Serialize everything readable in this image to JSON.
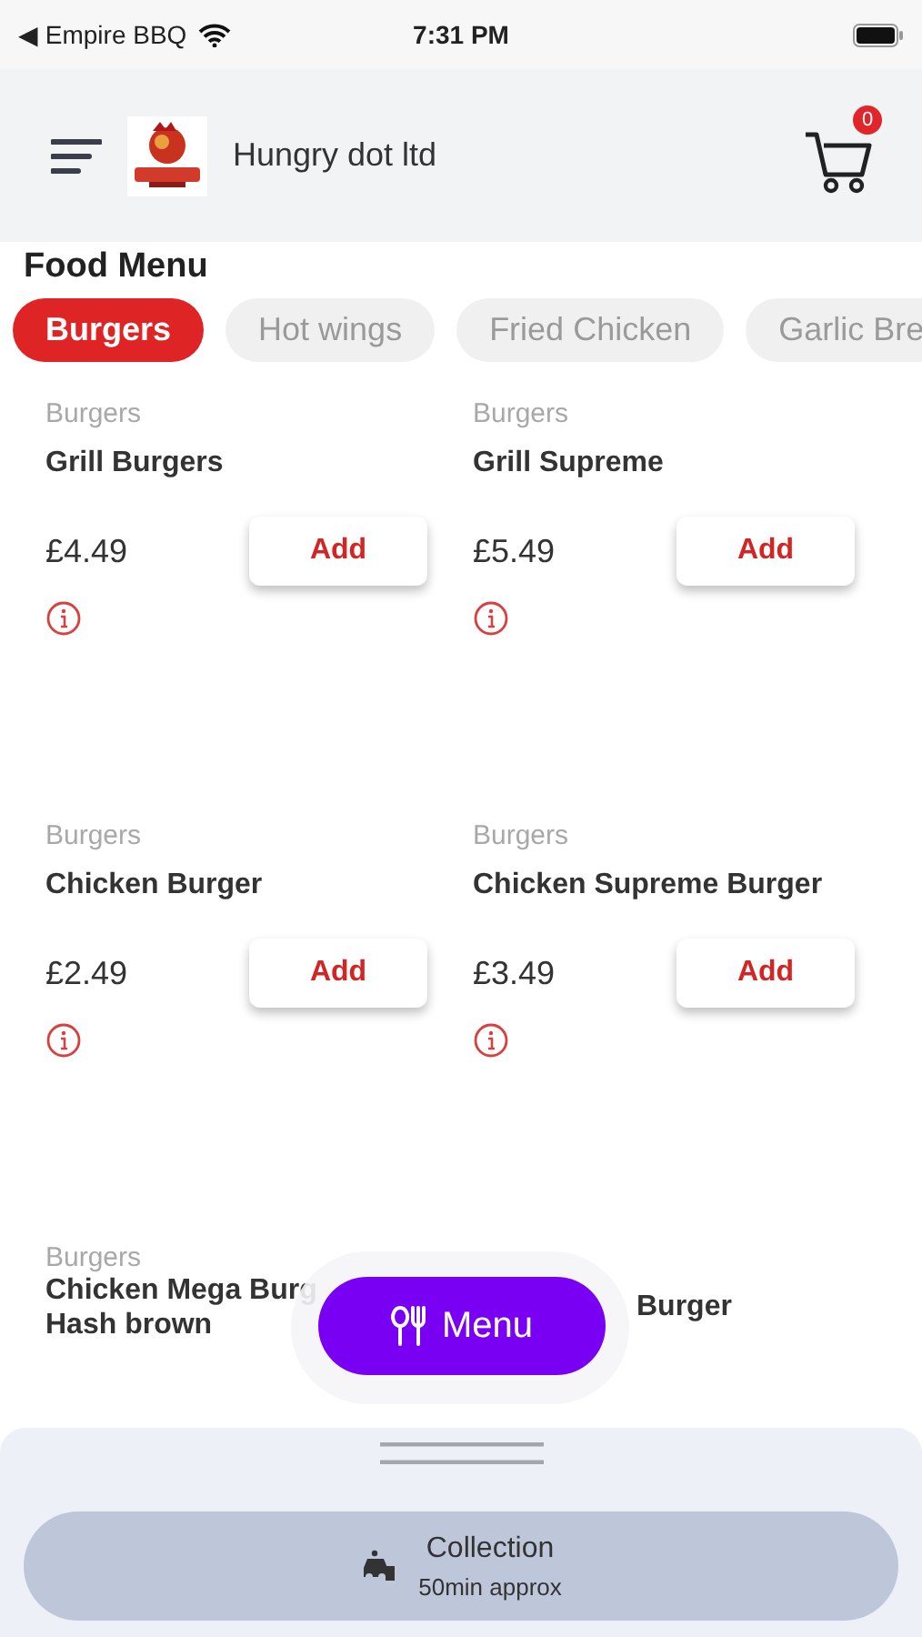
{
  "status_bar": {
    "back_app": "◀ Empire BBQ",
    "time": "7:31 PM"
  },
  "header": {
    "title": "Hungry dot ltd",
    "cart_count": "0"
  },
  "section_title": "Food Menu",
  "tabs": [
    {
      "label": "Burgers",
      "selected": true
    },
    {
      "label": "Hot wings",
      "selected": false
    },
    {
      "label": "Fried Chicken",
      "selected": false
    },
    {
      "label": "Garlic Bre",
      "selected": false
    }
  ],
  "items": [
    {
      "kind": "full",
      "category": "Burgers",
      "name": "Grill Burgers",
      "price": "£4.49",
      "button": "Add"
    },
    {
      "kind": "full",
      "category": "Burgers",
      "name": "Grill Supreme",
      "price": "£5.49",
      "button": "Add"
    },
    {
      "kind": "full",
      "category": "Burgers",
      "name": "Chicken Burger",
      "price": "£2.49",
      "button": "Add"
    },
    {
      "kind": "full",
      "category": "Burgers",
      "name": "Chicken Supreme Burger",
      "price": "£3.49",
      "button": "Add"
    },
    {
      "kind": "partial",
      "category": "Burgers",
      "name_lines": [
        "Chicken Mega Burg",
        "Hash brown"
      ]
    },
    {
      "kind": "partial_right",
      "name_lines": [
        "Burger"
      ]
    }
  ],
  "fab": {
    "label": "Menu"
  },
  "bottom_sheet": {
    "title": "Collection",
    "subtitle": "50min approx"
  }
}
